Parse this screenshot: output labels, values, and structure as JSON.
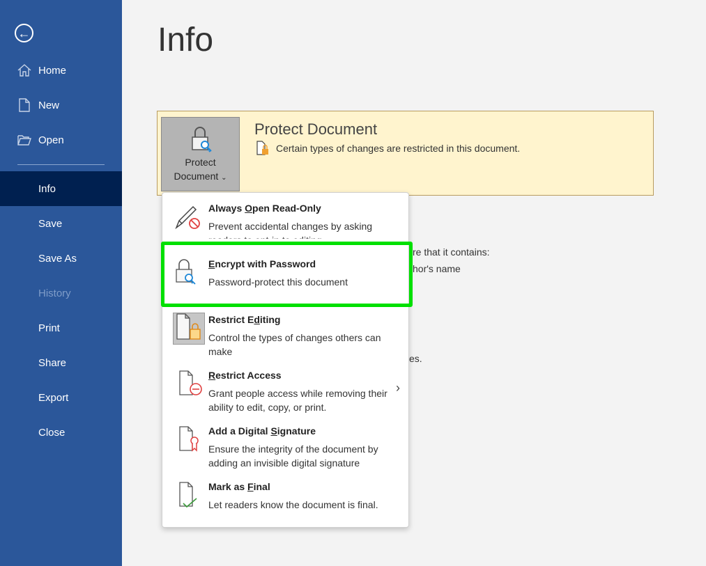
{
  "sidebar": {
    "back_icon": "back-arrow-icon",
    "items": [
      {
        "label": "Home",
        "icon": "home-icon"
      },
      {
        "label": "New",
        "icon": "new-document-icon"
      },
      {
        "label": "Open",
        "icon": "folder-open-icon"
      },
      {
        "label": "Info",
        "selected": true
      },
      {
        "label": "Save"
      },
      {
        "label": "Save As"
      },
      {
        "label": "History",
        "disabled": true
      },
      {
        "label": "Print"
      },
      {
        "label": "Share"
      },
      {
        "label": "Export"
      },
      {
        "label": "Close"
      }
    ]
  },
  "page": {
    "title": "Info"
  },
  "protect": {
    "button_line1": "Protect",
    "button_line2": "Document",
    "heading": "Protect Document",
    "description": "Certain types of changes are restricted in this document."
  },
  "background_text": {
    "line1": "re that it contains:",
    "line2": "hor's name",
    "line3": "es."
  },
  "menu": {
    "items": [
      {
        "pre": "Always ",
        "key": "O",
        "post": "pen Read-Only",
        "desc": "Prevent accidental changes by asking readers to opt-in to editing."
      },
      {
        "pre": "",
        "key": "E",
        "post": "ncrypt with Password",
        "desc": "Password-protect this document"
      },
      {
        "pre": "Restrict E",
        "key": "d",
        "post": "iting",
        "desc": "Control the types of changes others can make"
      },
      {
        "pre": "",
        "key": "R",
        "post": "estrict Access",
        "desc": "Grant people access while removing their ability to edit, copy, or print."
      },
      {
        "pre": "Add a Digital ",
        "key": "S",
        "post": "ignature",
        "desc": "Ensure the integrity of the document by adding an invisible digital signature"
      },
      {
        "pre": "Mark as ",
        "key": "F",
        "post": "inal",
        "desc": "Let readers know the document is final."
      }
    ]
  },
  "colors": {
    "sidebar": "#2b579a",
    "sidebar_selected": "#002050",
    "banner": "#fff4ce",
    "highlight": "#00e000"
  }
}
